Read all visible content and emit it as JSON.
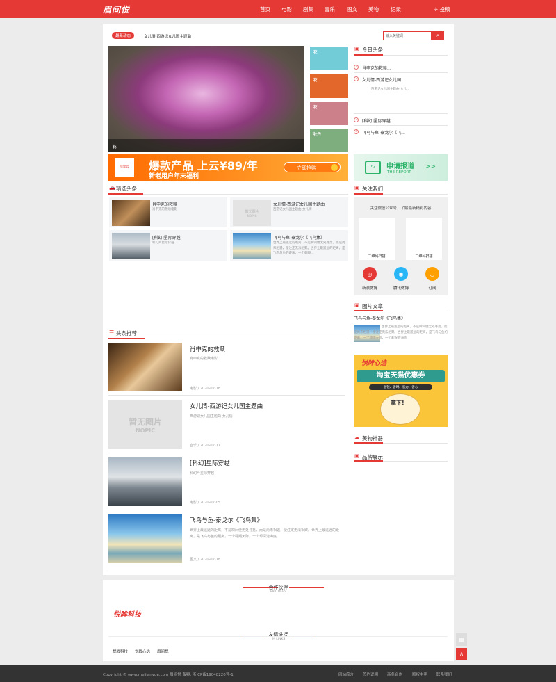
{
  "header": {
    "logo": "眉间悦",
    "nav": [
      "首页",
      "电影",
      "剧集",
      "音乐",
      "图文",
      "美物",
      "记录"
    ],
    "post": "投稿"
  },
  "ticker": {
    "tag": "最新动态",
    "text": "女儿情-西游记女儿国主题曲"
  },
  "search": {
    "placeholder": "输入关键词"
  },
  "slider": {
    "caption": "花",
    "side": [
      "花",
      "花",
      "花",
      "牡丹"
    ]
  },
  "banner_ad": {
    "brand": "阿里云",
    "title": "爆款产品 上云¥89/年",
    "sub": "新老用户年末福利",
    "btn": "立即抢购"
  },
  "featured": {
    "title": "精选头条",
    "items": [
      {
        "title": "肖申克的救赎",
        "desc": "肖申克的救赎电影"
      },
      {
        "title": "女儿情-西游记女儿国主题曲",
        "desc": "西游记女儿国主题曲-女儿情"
      },
      {
        "title": "[科幻]星际穿越",
        "desc": "科幻片星际穿越"
      },
      {
        "title": "飞鸟与鱼-泰戈尔《飞鸟集》",
        "desc": "世界上最遥远的距离，不是瞬间便无处寻觅，而是尚未相遇，便注定无法相聚。世界上最遥远的距离，是飞鸟与鱼的距离，一个翱翔..."
      }
    ]
  },
  "noimg": {
    "cn": "暂无图片",
    "en": "NOPIC"
  },
  "recommend": {
    "title": "头条推荐",
    "items": [
      {
        "title": "肖申克的救赎",
        "desc": "肖申克的救赎电影",
        "cat": "电影",
        "date": "2020-02-18"
      },
      {
        "title": "女儿情-西游记女儿国主题曲",
        "desc": "西游记女儿国主题曲-女儿情",
        "cat": "音乐",
        "date": "2020-02-17"
      },
      {
        "title": "[科幻]星际穿越",
        "desc": "科幻片星际穿越",
        "cat": "电影",
        "date": "2020-02-05"
      },
      {
        "title": "飞鸟与鱼-泰戈尔《飞鸟集》",
        "desc": "世界上最遥远的距离，不是瞬间便无处寻觅，而是尚未相遇，便注定无法相聚。世界上最遥远的距离，是飞鸟与鱼的距离，一个翱翔天际，一个却深潜海底",
        "cat": "图文",
        "date": "2020-02-18"
      }
    ]
  },
  "today": {
    "title": "今日头条",
    "items": [
      "肖申克的救赎...",
      "女儿情-西游记女儿国...",
      "[科幻]星际穿越...",
      "飞鸟与鱼-泰戈尔《飞..."
    ],
    "desc": "西游记女儿国主题曲-女儿..."
  },
  "report": {
    "title": "申请报道",
    "sub": "THE REPORT",
    "arrows": ">>"
  },
  "follow": {
    "title": "关注我们",
    "desc": "关注微信公众号，了解最新精彩内容",
    "qr": [
      "二维码扫描",
      "二维码扫描"
    ],
    "social": [
      "新浪微博",
      "腾讯微博",
      "订阅"
    ]
  },
  "picarticle": {
    "title": "图片文章",
    "item_title": "飞鸟与鱼-泰戈尔《飞鸟集》",
    "item_desc": "世界上最遥远的距离，不是瞬间便无处寻觅，而是尚未相遇，便注定无法相聚。世界上最遥远的距离，是飞鸟与鱼的距离，一个翱翔天际，一个却深潜海底"
  },
  "promo": {
    "brand": "悦眸心选",
    "title": "淘宝天猫优惠券",
    "sub": "省钱、省时、省力、省心",
    "mascot": "拿下!"
  },
  "sections": {
    "meiwu": "美物神器",
    "brand": "品牌展示"
  },
  "partners": {
    "title": "合作伙伴",
    "sub": "PARTNERS",
    "logo": "悦眸科技"
  },
  "links": {
    "title": "友情链接",
    "sub": "IM LINKS",
    "items": [
      "悦眸科技",
      "悦眸心选",
      "眉间悦"
    ]
  },
  "footer": {
    "copyright": "Copyright © www.meijianyue.com 眉间悦 备案: 浙ICP备19048220号-1",
    "links": [
      "网站简介",
      "签约说明",
      "商务合作",
      "版权申明",
      "联系我们"
    ]
  }
}
